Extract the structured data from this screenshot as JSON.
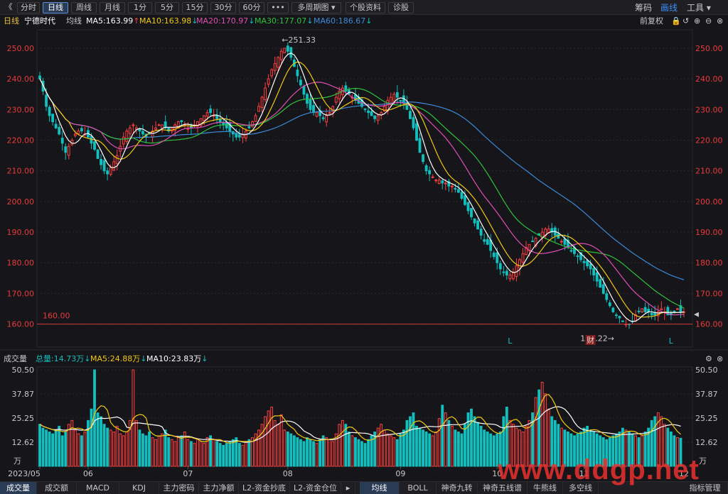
{
  "toolbar": {
    "back": "《",
    "periods": [
      "分时",
      "日线",
      "周线",
      "月线",
      "1分",
      "5分",
      "15分",
      "30分",
      "60分"
    ],
    "active_period": "日线",
    "more": "•••",
    "multi_period": "多周期图",
    "stock_info": "个股资料",
    "diagnose": "诊股",
    "chips": "筹码",
    "line_draw": "画线",
    "tools": "工具"
  },
  "header": {
    "period_label": "日线",
    "stock_name": "宁德时代",
    "ma_label": "均线",
    "ma5": "MA5:163.99",
    "ma10": "MA10:163.98",
    "ma20": "MA20:170.97",
    "ma30": "MA30:177.07",
    "ma60": "MA60:186.67",
    "adjust": "前复权"
  },
  "colors": {
    "up": "#ff4040",
    "down": "#13bfbf",
    "ma5": "#ffffff",
    "ma10": "#f0c814",
    "ma20": "#e04eb4",
    "ma30": "#2ec23c",
    "ma60": "#3b8ad8",
    "axis": "#e83b3b",
    "grid": "#2b2b2f"
  },
  "volume_header": {
    "title": "成交量",
    "total": "总量:14.73万",
    "ma5": "MA5:24.88万",
    "ma10": "MA10:23.83万"
  },
  "annotations": {
    "high": "251.33",
    "low": "158.22",
    "ref_line": "160.00",
    "marker_l": "L",
    "marker_fin": "财"
  },
  "bottom_tabs": [
    "成交量",
    "成交额",
    "MACD",
    "KDJ",
    "主力密码",
    "主力净额",
    "L2-资金抄底",
    "L2-资金仓位"
  ],
  "bottom_tabs_right": [
    "均线",
    "BOLL",
    "神奇九转",
    "神奇五线谱",
    "牛熊线",
    "多空线",
    "指标管理"
  ],
  "watermark": "www.ddgp.net",
  "chart_data": {
    "type": "candlestick",
    "price_axis": {
      "ticks": [
        250,
        240,
        230,
        220,
        210,
        200,
        190,
        180,
        170,
        160
      ],
      "labels": [
        "250.00",
        "240.00",
        "230.00",
        "220.00",
        "210.00",
        "200.00",
        "190.00",
        "180.00",
        "170.00",
        "160.00"
      ],
      "ylim": [
        152.5,
        256
      ]
    },
    "volume_axis": {
      "ticks": [
        50.5,
        37.87,
        25.25,
        12.62
      ],
      "labels": [
        "50.50",
        "37.87",
        "25.25",
        "12.62"
      ],
      "unit": "万",
      "ylim": [
        0,
        52
      ]
    },
    "x_labels": [
      {
        "i": 0,
        "text": "2023/05"
      },
      {
        "i": 15,
        "text": "06"
      },
      {
        "i": 46,
        "text": "07"
      },
      {
        "i": 77,
        "text": "08"
      },
      {
        "i": 112,
        "text": "09"
      },
      {
        "i": 142,
        "text": "10"
      },
      {
        "i": 169,
        "text": "11"
      },
      {
        "i": 200,
        "text": "12"
      }
    ],
    "closes": [
      240,
      236,
      231,
      228,
      226,
      224,
      222,
      219,
      216,
      218,
      220,
      222,
      223,
      223,
      222,
      221,
      219,
      217,
      214,
      212,
      210,
      209,
      211,
      213,
      215,
      218,
      221,
      223,
      224,
      225,
      224,
      223,
      222,
      221,
      222,
      223,
      224,
      225,
      225,
      224,
      223,
      224,
      225,
      226,
      226,
      225,
      224,
      224,
      225,
      226,
      227,
      228,
      229,
      229,
      228,
      227,
      226,
      225,
      224,
      223,
      222,
      221,
      221,
      222,
      223,
      224,
      226,
      228,
      231,
      234,
      237,
      240,
      243,
      245,
      247,
      249,
      250,
      249,
      247,
      244,
      241,
      238,
      235,
      232,
      230,
      229,
      229,
      228,
      227,
      228,
      229,
      231,
      234,
      236,
      237,
      236,
      235,
      234,
      233,
      232,
      231,
      230,
      229,
      228,
      227,
      228,
      229,
      231,
      233,
      234,
      235,
      234,
      233,
      232,
      230,
      227,
      224,
      220,
      216,
      213,
      210,
      209,
      208,
      207,
      207,
      206,
      206,
      205,
      205,
      204,
      203,
      201,
      199,
      197,
      195,
      193,
      191,
      189,
      187,
      186,
      184,
      182,
      180,
      178,
      177,
      176,
      176,
      177,
      179,
      181,
      183,
      185,
      186,
      187,
      188,
      189,
      190,
      191,
      191,
      190,
      189,
      188,
      187,
      186,
      185,
      184,
      183,
      182,
      181,
      180,
      179,
      178,
      176,
      174,
      172,
      170,
      168,
      166,
      164,
      163,
      162,
      161,
      160,
      160,
      161,
      163,
      164,
      165,
      164,
      164,
      163,
      163,
      164,
      165,
      164,
      163,
      163,
      164,
      165,
      164,
      164
    ],
    "volumes": [
      22,
      20,
      19,
      18,
      17,
      19,
      21,
      16,
      18,
      22,
      24,
      19,
      17,
      16,
      18,
      24,
      30,
      50.5,
      28,
      26,
      22,
      20,
      19,
      18,
      21,
      17,
      16,
      18,
      24,
      50.5,
      24,
      19,
      17,
      16,
      18,
      15,
      14,
      16,
      17,
      19,
      15,
      14,
      13,
      15,
      16,
      18,
      14,
      13,
      12,
      14,
      13,
      12,
      15,
      16,
      14,
      13,
      12,
      11,
      12,
      13,
      14,
      15,
      12,
      11,
      13,
      14,
      15,
      17,
      19,
      22,
      26,
      29,
      31,
      24,
      22,
      27,
      19,
      18,
      17,
      16,
      15,
      14,
      13,
      15,
      14,
      13,
      12,
      14,
      16,
      15,
      14,
      13,
      17,
      22,
      24,
      22,
      18,
      16,
      15,
      14,
      13,
      12,
      14,
      16,
      18,
      20,
      22,
      19,
      17,
      16,
      15,
      14,
      17,
      19,
      24,
      26,
      28,
      21,
      20,
      19,
      18,
      17,
      16,
      18,
      25,
      32,
      28,
      24,
      21,
      19,
      18,
      17,
      22,
      28,
      30,
      26,
      23,
      21,
      19,
      18,
      17,
      16,
      17,
      18,
      26,
      31,
      24,
      22,
      20,
      19,
      18,
      21,
      24,
      28,
      36,
      40,
      44,
      38,
      30,
      26,
      24,
      22,
      20,
      19,
      18,
      17,
      16,
      17,
      18,
      20,
      21,
      19,
      18,
      17,
      16,
      15,
      14,
      15,
      16,
      17,
      18,
      20,
      19,
      18,
      17,
      16,
      15,
      16,
      18,
      20,
      24,
      26,
      28,
      26,
      22,
      20,
      18,
      16,
      15,
      14.73
    ],
    "ma_last": {
      "MA5": 163.99,
      "MA10": 163.98,
      "MA20": 170.97,
      "MA30": 177.07,
      "MA60": 186.67
    },
    "high_point": {
      "i": 76,
      "value": 251.33
    },
    "low_point": {
      "i": 181,
      "value": 158.22
    },
    "reference_line": 160.0
  }
}
